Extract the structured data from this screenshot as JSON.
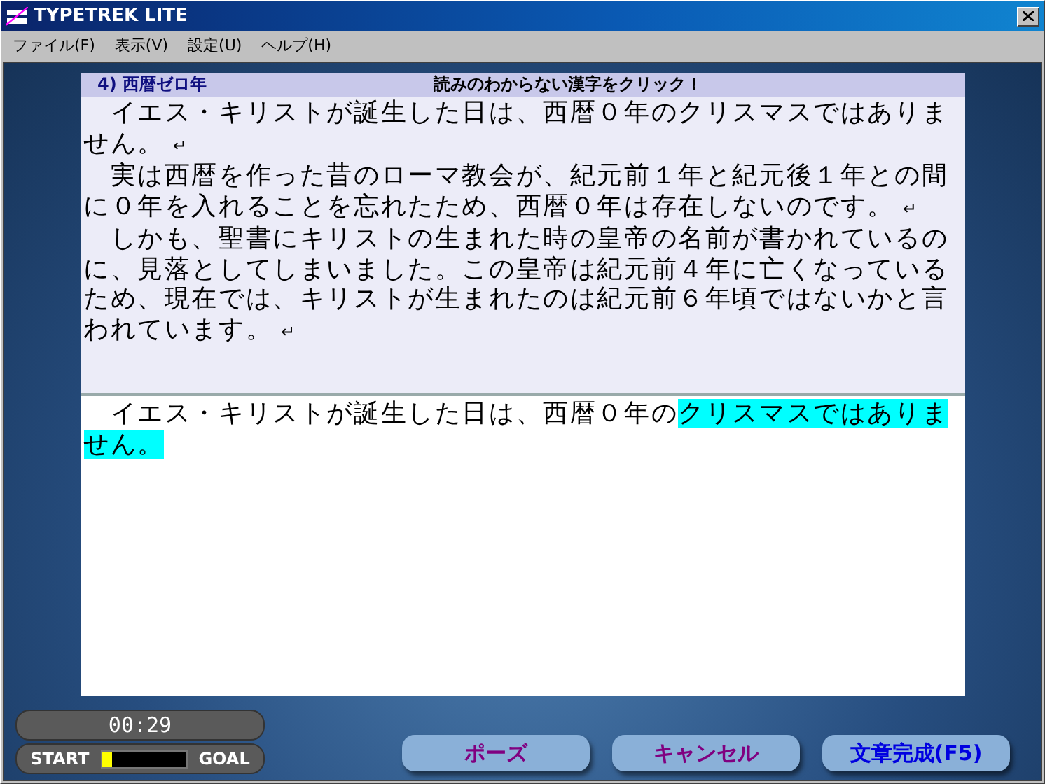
{
  "window": {
    "title": "TYPETREK LITE"
  },
  "menu": [
    "ファイル(F)",
    "表示(V)",
    "設定(U)",
    "ヘルプ(H)"
  ],
  "lesson": {
    "title": "4) 西暦ゼロ年",
    "instruction": "読みのわからない漢字をクリック！"
  },
  "paragraphs": [
    "　イエス・キリストが誕生した日は、西暦０年のクリスマスではありません。",
    "　実は西暦を作った昔のローマ教会が、紀元前１年と紀元後１年との間に０年を入れることを忘れたため、西暦０年は存在しないのです。",
    "　しかも、聖書にキリストの生まれた時の皇帝の名前が書かれているのに、見落としてしまいました。この皇帝は紀元前４年に亡くなっているため、現在では、キリストが生まれたのは紀元前６年頃ではないかと言われています。"
  ],
  "return_mark": "↵",
  "typing": {
    "typed": "　イエス・キリストが誕生した日は、西暦０年の",
    "highlighted": "クリスマスではありません。"
  },
  "timer": "00:29",
  "progress": {
    "start_label": "START",
    "goal_label": "GOAL",
    "level": 0.12
  },
  "buttons": [
    {
      "label": "ポーズ",
      "kind": "pause"
    },
    {
      "label": "キャンセル",
      "kind": "cancel"
    },
    {
      "label": "文章完成(F5)",
      "kind": "finish"
    }
  ]
}
